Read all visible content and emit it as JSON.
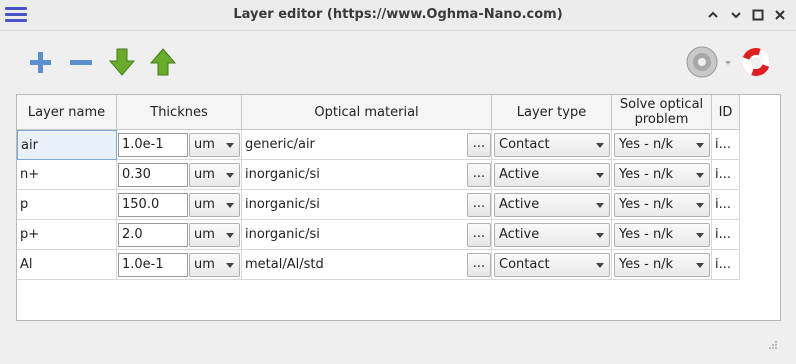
{
  "window": {
    "title": "Layer editor (https://www.Oghma-Nano.com)",
    "controls": {
      "up": "⌃",
      "down": "⌄",
      "close": "✕",
      "maximize": "□"
    }
  },
  "toolbar": {
    "add": "add-layer",
    "remove": "remove-layer",
    "move_down": "move-layer-down",
    "move_up": "move-layer-up"
  },
  "table": {
    "headers": {
      "name": "Layer name",
      "thickness": "Thicknes",
      "material": "Optical material",
      "type": "Layer type",
      "solve": "Solve optical problem",
      "id": "ID"
    },
    "rows": [
      {
        "name": "air",
        "thickness": "1.0e-1",
        "unit": "um",
        "material": "generic/air",
        "dots": "...",
        "type": "Contact",
        "solve": "Yes - n/k",
        "id": "i..."
      },
      {
        "name": "n+",
        "thickness": "0.30",
        "unit": "um",
        "material": "inorganic/si",
        "dots": "...",
        "type": "Active",
        "solve": "Yes - n/k",
        "id": "i..."
      },
      {
        "name": "p",
        "thickness": "150.0",
        "unit": "um",
        "material": "inorganic/si",
        "dots": "...",
        "type": "Active",
        "solve": "Yes - n/k",
        "id": "i..."
      },
      {
        "name": "p+",
        "thickness": "2.0",
        "unit": "um",
        "material": "inorganic/si",
        "dots": "...",
        "type": "Active",
        "solve": "Yes - n/k",
        "id": "i..."
      },
      {
        "name": "Al",
        "thickness": "1.0e-1",
        "unit": "um",
        "material": "metal/Al/std",
        "dots": "...",
        "type": "Contact",
        "solve": "Yes - n/k",
        "id": "i..."
      }
    ]
  }
}
